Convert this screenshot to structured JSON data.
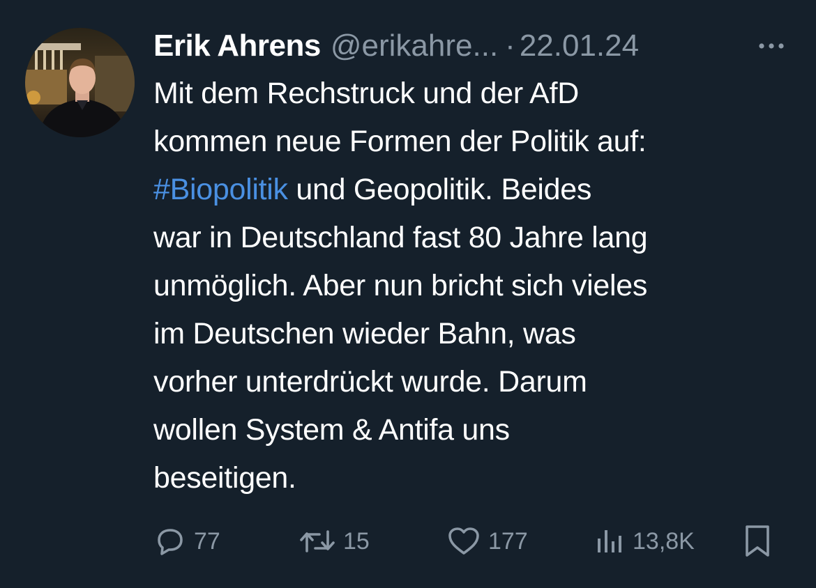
{
  "tweet": {
    "author_name": "Erik Ahrens",
    "handle": "@erikahre...",
    "separator": "·",
    "date": "22.01.24",
    "text_lines": [
      [
        {
          "text": "Mit dem Rechstruck und der AfD",
          "hashtag": false
        }
      ],
      [
        {
          "text": "kommen neue Formen der Politik auf:",
          "hashtag": false
        }
      ],
      [
        {
          "text": "#Biopolitik",
          "hashtag": true
        },
        {
          "text": " und Geopolitik. Beides",
          "hashtag": false
        }
      ],
      [
        {
          "text": "war in Deutschland fast 80 Jahre lang",
          "hashtag": false
        }
      ],
      [
        {
          "text": "unmöglich. Aber nun bricht sich vieles",
          "hashtag": false
        }
      ],
      [
        {
          "text": "im Deutschen wieder Bahn, was",
          "hashtag": false
        }
      ],
      [
        {
          "text": "vorher unterdrückt wurde. Darum",
          "hashtag": false
        }
      ],
      [
        {
          "text": "wollen System & Antifa uns",
          "hashtag": false
        }
      ],
      [
        {
          "text": "beseitigen.",
          "hashtag": false
        }
      ]
    ]
  },
  "actions": {
    "reply": {
      "icon": "reply-icon",
      "count": "77"
    },
    "retweet": {
      "icon": "retweet-icon",
      "count": "15"
    },
    "like": {
      "icon": "heart-icon",
      "count": "177"
    },
    "views": {
      "icon": "views-icon",
      "count": "13,8K"
    },
    "bookmark": {
      "icon": "bookmark-icon"
    }
  },
  "colors": {
    "background": "#15202b",
    "text": "#ffffff",
    "secondary": "#8b98a5",
    "hashtag": "#4a90e2"
  }
}
